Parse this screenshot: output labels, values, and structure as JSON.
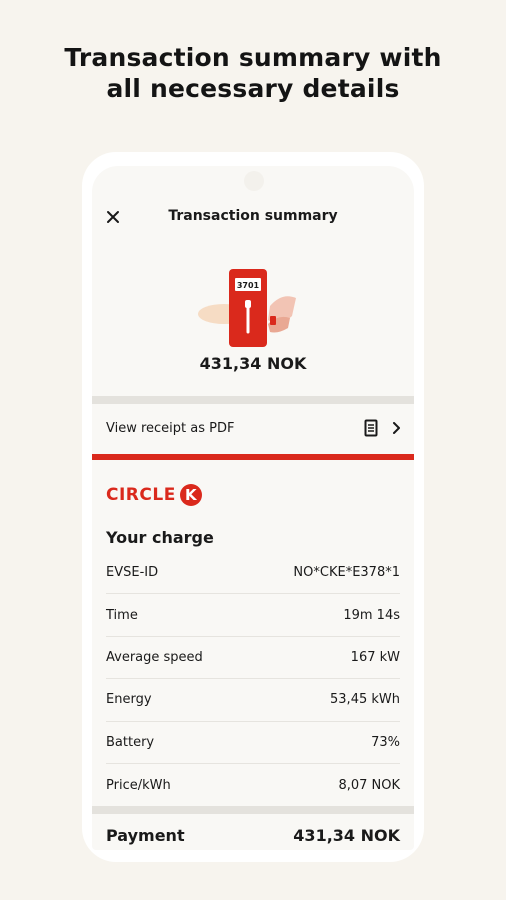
{
  "headline": {
    "line1": "Transaction summary with",
    "line2": "all necessary details"
  },
  "screen": {
    "title": "Transaction summary",
    "amount": "431,34 NOK",
    "illustration_label": "3701",
    "receipt_label": "View receipt as PDF",
    "brand": {
      "text": "CIRCLE",
      "mark": "K"
    },
    "section_title": "Your charge",
    "details": [
      {
        "label": "EVSE-ID",
        "value": "NO*CKE*E378*1"
      },
      {
        "label": "Time",
        "value": "19m 14s"
      },
      {
        "label": "Average speed",
        "value": "167 kW"
      },
      {
        "label": "Energy",
        "value": "53,45 kWh"
      },
      {
        "label": "Battery",
        "value": "73%"
      },
      {
        "label": "Price/kWh",
        "value": "8,07 NOK"
      }
    ],
    "payment": {
      "label": "Payment",
      "value": "431,34 NOK"
    }
  },
  "colors": {
    "brand_red": "#da291c",
    "background": "#f7f4ee"
  },
  "icons": [
    "close-icon",
    "receipt-document-icon",
    "chevron-right-icon",
    "charger-illustration"
  ]
}
